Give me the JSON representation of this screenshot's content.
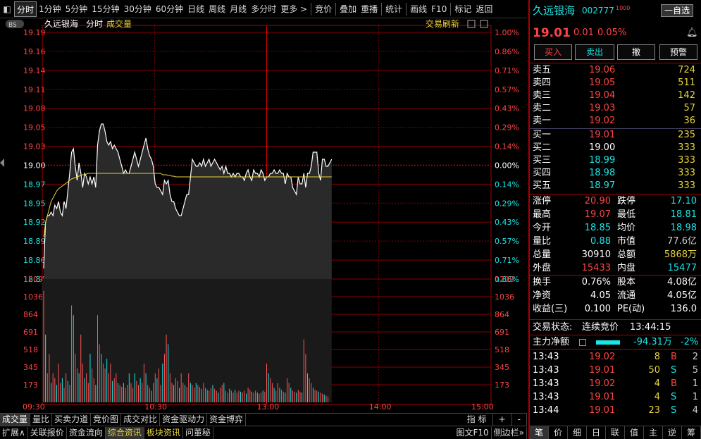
{
  "toolbar": {
    "items": [
      "分时",
      "1分钟",
      "5分钟",
      "15分钟",
      "30分钟",
      "60分钟",
      "日线",
      "周线",
      "月线",
      "多分时",
      "更多 >",
      "竞价",
      "叠加",
      "重播",
      "统计",
      "画线",
      "F10",
      "标记",
      "返回"
    ]
  },
  "chart": {
    "stock_label": "久远银海",
    "mode_label": "分时",
    "volume_label": "成交量",
    "refresh_label": "交易刷新",
    "bs_badge": "BS",
    "price_ticks": [
      "19.19",
      "19.16",
      "19.14",
      "19.11",
      "19.08",
      "19.05",
      "19.03",
      "19.00",
      "18.97",
      "18.95",
      "18.92",
      "18.89",
      "18.86",
      "18.84"
    ],
    "pct_ticks": [
      "1.00%",
      "0.86%",
      "0.71%",
      "0.57%",
      "0.43%",
      "0.29%",
      "0.14%",
      "0.00%",
      "0.14%",
      "0.29%",
      "0.43%",
      "0.57%",
      "0.71%",
      "0.86%"
    ],
    "vol_ticks": [
      "1209",
      "1036",
      "864",
      "691",
      "518",
      "345",
      "173"
    ],
    "time_ticks": [
      "09:30",
      "10:30",
      "13:00",
      "14:00",
      "15:00"
    ],
    "ref_price": 19.0,
    "price_max": 19.19,
    "price_min": 18.84,
    "vol_max": 1209,
    "price_series": [
      18.855,
      18.92,
      18.93,
      18.93,
      18.935,
      18.93,
      18.945,
      18.94,
      18.95,
      18.935,
      18.93,
      18.95,
      18.94,
      18.965,
      18.99,
      19.02,
      19.025,
      19.0,
      18.98,
      19.005,
      18.99,
      18.97,
      18.99,
      18.985,
      18.975,
      18.985,
      18.975,
      18.985,
      18.97,
      19.03,
      19.05,
      19.06,
      19.06,
      19.05,
      19.035,
      19.03,
      19.035,
      19.025,
      19.03,
      19.025,
      19.02,
      19.01,
      19.0,
      18.99,
      18.995,
      18.99,
      18.99,
      19.0,
      19.01,
      19.02,
      19.01,
      19.0,
      19.01,
      19.02,
      19.03,
      19.04,
      19.025,
      19.015,
      19.01,
      19.0,
      18.975,
      18.97,
      18.97,
      18.965,
      18.96,
      18.98,
      18.975,
      18.98,
      18.96,
      18.95,
      18.95,
      18.94,
      18.935,
      18.93,
      18.93,
      18.94,
      18.95,
      18.96,
      18.96,
      18.985,
      19.01,
      19.005,
      19.0,
      19.0,
      19.005,
      19.0,
      19.01,
      19.0,
      19.005,
      19.01,
      19.0,
      19.005,
      19.01,
      19.005,
      19.0,
      18.995,
      19.0,
      18.99,
      19.0,
      18.99,
      18.99,
      18.985,
      18.99,
      18.985,
      18.99,
      18.99,
      18.985,
      18.985,
      18.98,
      18.99,
      18.995,
      18.985,
      18.98,
      18.995,
      18.99,
      18.99,
      18.985,
      18.995,
      18.99,
      18.98,
      18.985,
      18.985,
      18.99,
      18.99,
      18.995,
      18.99,
      18.99,
      18.995,
      18.99,
      18.99,
      18.975,
      18.99,
      18.985,
      18.985,
      18.97,
      18.965,
      18.96,
      18.985,
      18.975,
      18.975,
      18.99,
      18.97,
      18.99,
      18.99,
      19.0,
      19.02,
      19.02,
      19.02,
      18.99,
      18.98,
      19.01,
      19.01,
      19.0,
      19.0,
      19.005,
      19.01
    ],
    "avg_series": [
      18.9,
      18.92,
      18.93,
      18.94,
      18.95,
      18.955,
      18.96,
      18.965,
      18.968,
      18.97,
      18.972,
      18.974,
      18.976,
      18.978,
      18.98,
      18.982,
      18.983,
      18.984,
      18.985,
      18.986,
      18.987,
      18.988,
      18.988,
      18.989,
      18.99,
      18.99,
      18.99,
      18.99,
      18.99,
      18.99,
      18.99,
      18.99,
      18.99,
      18.99,
      18.99,
      18.99,
      18.99,
      18.99,
      18.99,
      18.99,
      18.99,
      18.99,
      18.99,
      18.99,
      18.99,
      18.99,
      18.99,
      18.99,
      18.99,
      18.99,
      18.99,
      18.99,
      18.99,
      18.99,
      18.99,
      18.99,
      18.99,
      18.99,
      18.99,
      18.99,
      18.99,
      18.99,
      18.99,
      18.99,
      18.988,
      18.988,
      18.988,
      18.987,
      18.987,
      18.986,
      18.986,
      18.985,
      18.985,
      18.985,
      18.985,
      18.985,
      18.985,
      18.985,
      18.985,
      18.985,
      18.985,
      18.985,
      18.985,
      18.985,
      18.985,
      18.985,
      18.985,
      18.985,
      18.985,
      18.985,
      18.985,
      18.985,
      18.985,
      18.985,
      18.985,
      18.985,
      18.985,
      18.985,
      18.985,
      18.985,
      18.985,
      18.985,
      18.985,
      18.985,
      18.985,
      18.985,
      18.985,
      18.985,
      18.985,
      18.985,
      18.985,
      18.985,
      18.985,
      18.985,
      18.985,
      18.985,
      18.985,
      18.985,
      18.985,
      18.985,
      18.985,
      18.985,
      18.985,
      18.985,
      18.985,
      18.985,
      18.985,
      18.985,
      18.985,
      18.985,
      18.985,
      18.985,
      18.985,
      18.985,
      18.985,
      18.985,
      18.985,
      18.985,
      18.985,
      18.985,
      18.985,
      18.985,
      18.985,
      18.985,
      18.985,
      18.985,
      18.985,
      18.985,
      18.985,
      18.985,
      18.985,
      18.985,
      18.985,
      18.985,
      18.985,
      18.985
    ],
    "volume_series": [
      1150,
      700,
      300,
      500,
      200,
      300,
      250,
      180,
      400,
      200,
      250,
      150,
      300,
      220,
      180,
      1000,
      900,
      500,
      350,
      300,
      700,
      400,
      250,
      300,
      200,
      500,
      350,
      250,
      180,
      900,
      600,
      500,
      400,
      350,
      450,
      300,
      400,
      220,
      250,
      300,
      200,
      180,
      160,
      200,
      150,
      180,
      300,
      200,
      150,
      300,
      220,
      180,
      250,
      200,
      400,
      300,
      180,
      150,
      120,
      200,
      300,
      250,
      350,
      180,
      400,
      500,
      700,
      600,
      300,
      200,
      180,
      250,
      220,
      150,
      300,
      200,
      180,
      160,
      300,
      200,
      180,
      150,
      200,
      180,
      160,
      140,
      200,
      150,
      130,
      120,
      150,
      180,
      140,
      120,
      100,
      150,
      180,
      200,
      120,
      100,
      140,
      120,
      100,
      130,
      100,
      120,
      110,
      100,
      120,
      90,
      150,
      130,
      110,
      100,
      120,
      100,
      90,
      100,
      120,
      110,
      400,
      300,
      250,
      200,
      150,
      120,
      200,
      150,
      130,
      110,
      100,
      250,
      200,
      150,
      120,
      110,
      100,
      130,
      110,
      100,
      650,
      500,
      300,
      250,
      200,
      150,
      130,
      120,
      110,
      100,
      90,
      80,
      70,
      60
    ],
    "volume_colors": "mixed"
  },
  "quote": {
    "name": "久远银海",
    "code": "002777",
    "tag": "1000",
    "self_select": "一自选",
    "price": "19.01",
    "change": "0.01",
    "change_pct": "0.05%",
    "buy_btn": "买入",
    "sell_btn": "卖出",
    "cancel_btn": "撤",
    "alert_btn": "预警",
    "asks": [
      {
        "label": "卖五",
        "price": "19.06",
        "vol": "724"
      },
      {
        "label": "卖四",
        "price": "19.05",
        "vol": "511"
      },
      {
        "label": "卖三",
        "price": "19.04",
        "vol": "142"
      },
      {
        "label": "卖二",
        "price": "19.03",
        "vol": "57"
      },
      {
        "label": "卖一",
        "price": "19.02",
        "vol": "36"
      }
    ],
    "bids": [
      {
        "label": "买一",
        "price": "19.01",
        "vol": "235"
      },
      {
        "label": "买二",
        "price": "19.00",
        "vol": "333"
      },
      {
        "label": "买三",
        "price": "18.99",
        "vol": "333"
      },
      {
        "label": "买四",
        "price": "18.98",
        "vol": "333"
      },
      {
        "label": "买五",
        "price": "18.97",
        "vol": "333"
      }
    ],
    "stats": [
      {
        "l1": "涨停",
        "v1": "20.90",
        "c1": "red",
        "l2": "跌停",
        "v2": "17.10",
        "c2": "green"
      },
      {
        "l1": "最高",
        "v1": "19.07",
        "c1": "red",
        "l2": "最低",
        "v2": "18.81",
        "c2": "green"
      },
      {
        "l1": "今开",
        "v1": "18.85",
        "c1": "green",
        "l2": "均价",
        "v2": "18.98",
        "c2": "green"
      },
      {
        "l1": "量比",
        "v1": "0.88",
        "c1": "green",
        "l2": "市值",
        "v2": "77.6亿",
        "c2": "grey"
      },
      {
        "l1": "总量",
        "v1": "30910",
        "c1": "wht",
        "l2": "总额",
        "v2": "5868万",
        "c2": "yel"
      },
      {
        "l1": "外盘",
        "v1": "15433",
        "c1": "red",
        "l2": "内盘",
        "v2": "15477",
        "c2": "green"
      }
    ],
    "stats2": [
      {
        "l1": "换手",
        "v1": "0.76%",
        "l2": "股本",
        "v2": "4.08亿"
      },
      {
        "l1": "净资",
        "v1": "4.05",
        "l2": "流通",
        "v2": "4.05亿"
      },
      {
        "l1": "收益(三)",
        "v1": "0.100",
        "l2": "PE(动)",
        "v2": "136.0"
      }
    ],
    "trade_status_label": "交易状态:",
    "trade_status": "连续竞价",
    "trade_time": "13:44:15",
    "main_flow_label": "主力净额",
    "main_flow_value": "-94.31万",
    "main_flow_pct": "-2%",
    "ticks": [
      {
        "time": "13:43",
        "price": "19.02",
        "vol": "8",
        "side": "B",
        "n": "2"
      },
      {
        "time": "13:43",
        "price": "19.01",
        "vol": "50",
        "side": "S",
        "n": "5"
      },
      {
        "time": "13:43",
        "price": "19.02",
        "vol": "4",
        "side": "B",
        "n": "1"
      },
      {
        "time": "13:43",
        "price": "19.01",
        "vol": "4",
        "side": "S",
        "n": "1"
      },
      {
        "time": "13:44",
        "price": "19.01",
        "vol": "23",
        "side": "S",
        "n": "4"
      }
    ]
  },
  "bottom_tabs": [
    "成交量",
    "量比",
    "买卖力道",
    "竞价图",
    "成交对比",
    "资金驱动力",
    "资金博弈"
  ],
  "bottom_right": [
    "指 标",
    "+",
    "-"
  ],
  "bottom_tabs2": [
    "扩展∧",
    "关联报价",
    "资金流向",
    "综合资讯",
    "板块资讯",
    "问董秘"
  ],
  "bottom_tabs2_right": [
    "图文F10",
    "侧边栏»"
  ],
  "rp_tabs": [
    "笔",
    "价",
    "细",
    "日",
    "联",
    "值",
    "主",
    "逆",
    "筹"
  ]
}
